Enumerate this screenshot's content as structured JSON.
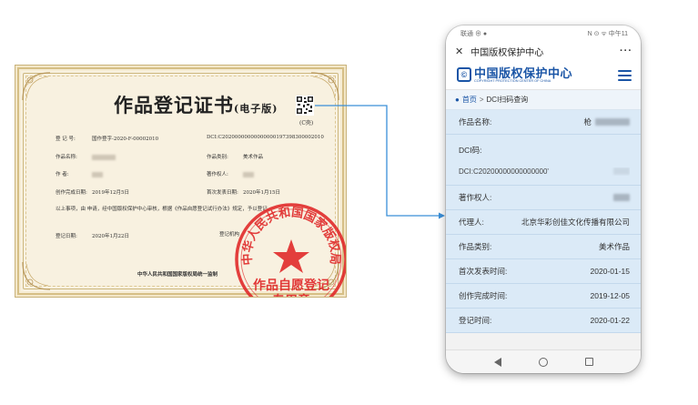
{
  "certificate": {
    "title": "作品登记证书",
    "title_suffix": "(电子版)",
    "qr_label": "(C壳)",
    "rows": [
      {
        "label": "登 记 号:",
        "value": "国作登字-2020-F-00002010",
        "label2": "DCI:C20200000000000000197398300002010",
        "value2": ""
      },
      {
        "label": "作品名称:",
        "value": "",
        "label2": "作品类别:",
        "value2": "美术作品"
      },
      {
        "label": "作    者:",
        "value": "",
        "label2": "著作权人:",
        "value2": ""
      },
      {
        "label": "创作完成日期:",
        "value": "2019年12月5日",
        "label2": "首次发表日期:",
        "value2": "2020年1月15日"
      }
    ],
    "paragraph": "以上事项，由      申请，经中国版权保护中心审核，根据《作品自愿登记试行办法》规定，予以登记。",
    "reg_date_label": "登记日期:",
    "reg_date_value": "2020年1月22日",
    "reg_org_label": "登记机构",
    "footer": "中华人民共和国国家版权局统一监制",
    "seal": {
      "ring_text": "中华人民共和国国家版权局",
      "line1": "作品自愿登记",
      "line2": "专用章",
      "color": "#e02a2a"
    }
  },
  "phone": {
    "status": {
      "left": "联通 ⊕ ●",
      "right": "N ⊙ ᯤ 中午11"
    },
    "app_bar": {
      "close": "✕",
      "title": "中国版权保护中心",
      "more": "···"
    },
    "logo": {
      "mark": "©",
      "cn": "中国版权保护中心",
      "en": "COPYRIGHT PROTECTION CENTER OF CHINA"
    },
    "breadcrumb": {
      "home": "首页",
      "sep": ">",
      "current": "DCI扫码查询"
    },
    "fields": {
      "work_name": {
        "label": "作品名称:",
        "value": "枪"
      },
      "dci": {
        "label": "DCI码:",
        "value": "DCI:C20200000000000000'"
      },
      "owner": {
        "label": "著作权人:"
      },
      "agent": {
        "label": "代理人:",
        "value": "北京华彩创佳文化传播有限公司"
      },
      "category": {
        "label": "作品类别:",
        "value": "美术作品"
      },
      "first_pub": {
        "label": "首次发表时间:",
        "value": "2020-01-15"
      },
      "completed": {
        "label": "创作完成时间:",
        "value": "2019-12-05"
      },
      "registered": {
        "label": "登记时间:",
        "value": "2020-01-22"
      }
    }
  },
  "colors": {
    "accent": "#1a55a6",
    "connector": "#3a8fd8",
    "field_bg": "#dbeaf7"
  }
}
